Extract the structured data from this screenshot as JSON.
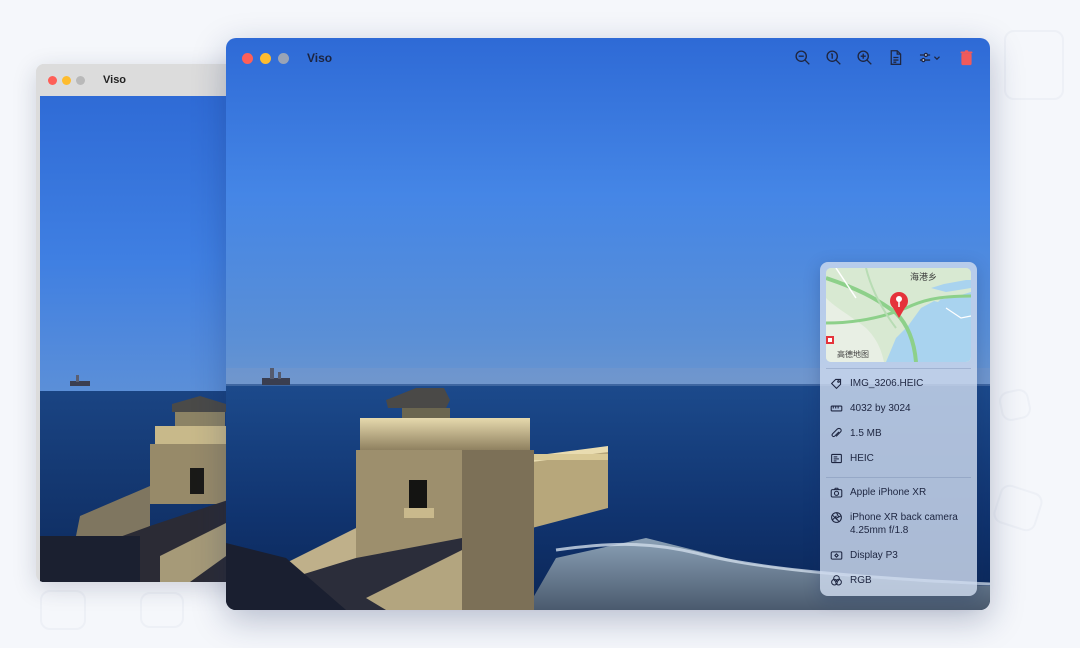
{
  "back_window": {
    "title": "Viso"
  },
  "front_window": {
    "title": "Viso",
    "toolbar": [
      {
        "icon": "zoom-out-icon"
      },
      {
        "icon": "actual-size-icon"
      },
      {
        "icon": "zoom-in-icon"
      },
      {
        "icon": "info-document-icon"
      },
      {
        "icon": "adjustments-menu-icon"
      },
      {
        "icon": "trash-icon"
      }
    ]
  },
  "info_panel": {
    "map": {
      "place_label": "海港乡",
      "attribution": "高德地图"
    },
    "file": {
      "filename": "IMG_3206.HEIC",
      "dimensions": "4032 by 3024",
      "size": "1.5 MB",
      "format": "HEIC"
    },
    "camera": {
      "device": "Apple iPhone XR",
      "lens": "iPhone XR back camera 4.25mm f/1.8",
      "color_profile": "Display P3",
      "color_model": "RGB"
    }
  },
  "colors": {
    "sky_top": "#2e6fd9",
    "sky_mid": "#4a87e8",
    "sea": "#0f2f66",
    "traffic_red": "#fe5f57",
    "traffic_yellow": "#febc2e",
    "trash_red": "#f05a5a",
    "pin_red": "#e5333b"
  }
}
